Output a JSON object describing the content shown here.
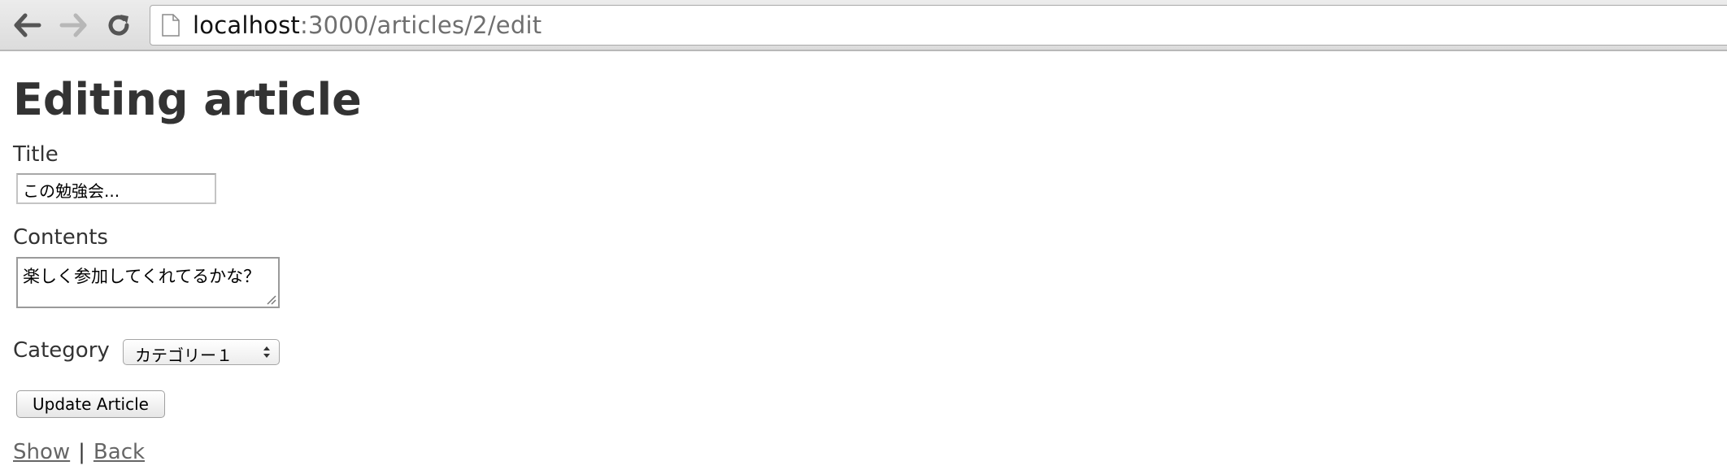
{
  "browser": {
    "url_host": "localhost",
    "url_path": ":3000/articles/2/edit"
  },
  "page": {
    "title": "Editing article"
  },
  "form": {
    "title_label": "Title",
    "title_value": "この勉強会...",
    "contents_label": "Contents",
    "contents_value": "楽しく参加してくれてるかな？",
    "category_label": "Category",
    "category_selected": "カテゴリー１",
    "submit_label": "Update Article"
  },
  "links": {
    "show": "Show",
    "separator": "|",
    "back": "Back"
  }
}
